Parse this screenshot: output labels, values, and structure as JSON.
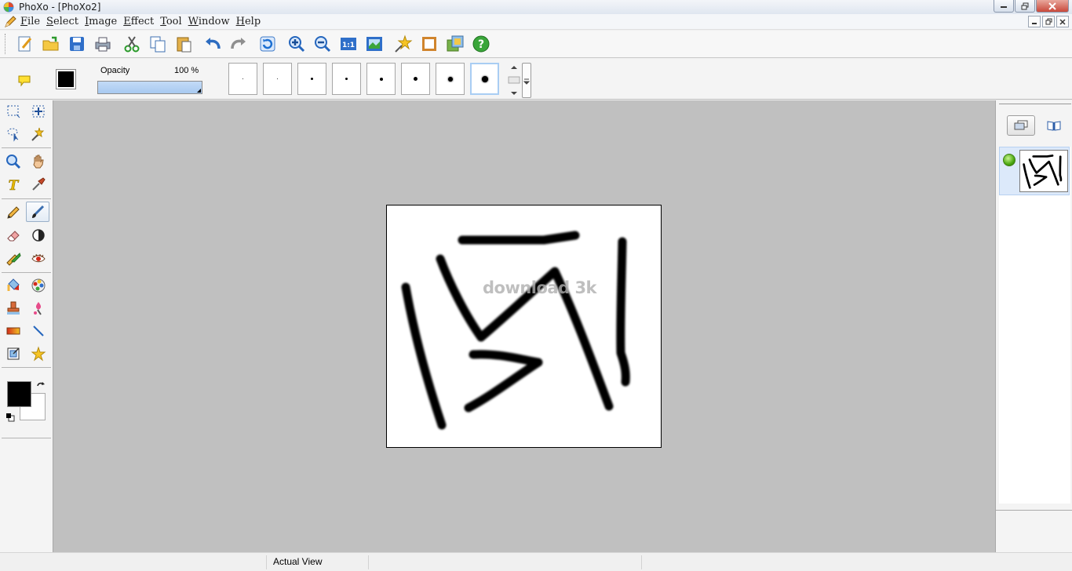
{
  "window": {
    "title": "PhoXo - [PhoXo2]",
    "controls": [
      "minimize",
      "restore",
      "close"
    ]
  },
  "menu": {
    "items": [
      "File",
      "Select",
      "Image",
      "Effect",
      "Tool",
      "Window",
      "Help"
    ]
  },
  "toolbar": {
    "buttons": [
      "new",
      "open",
      "save",
      "print",
      "cut",
      "copy",
      "paste",
      "undo",
      "redo",
      "refresh",
      "zoom-in",
      "zoom-out",
      "actual-size",
      "fit-window",
      "effects",
      "frame",
      "gallery",
      "help"
    ]
  },
  "options": {
    "opacity_label": "Opacity",
    "opacity_value": "100 %",
    "opacity_fraction": 1.0,
    "brush_color": "#000000",
    "brush_sizes": [
      1,
      1,
      3,
      3,
      4,
      5,
      6,
      8
    ],
    "selected_brush_index": 7
  },
  "tools": {
    "active": "brush",
    "foreground_color": "#000000",
    "background_color": "#ffffff"
  },
  "canvas": {
    "watermark": "download 3k"
  },
  "layers": {
    "items": [
      {
        "visible": true,
        "selected": true
      }
    ]
  },
  "status": {
    "view_mode": "Actual View"
  }
}
